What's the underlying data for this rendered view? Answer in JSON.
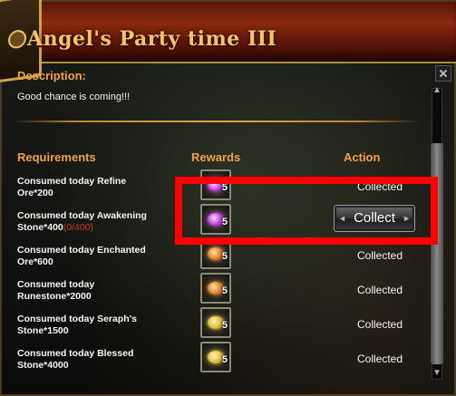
{
  "window": {
    "title": "Angel's Party time III",
    "description_label": "Description:",
    "description_text": "Good chance is coming!!!"
  },
  "headers": {
    "requirements": "Requirements",
    "rewards": "Rewards",
    "action": "Action"
  },
  "rows": [
    {
      "req_line1": "Consumed today Refine",
      "req_line2": "Ore*200",
      "progress": "",
      "reward_qty": "5",
      "reward_icon": "purple-gem-icon",
      "action": "Collected"
    },
    {
      "req_line1": "Consumed today Awakening",
      "req_line2": "Stone*400",
      "progress": "(0/400)",
      "reward_qty": "5",
      "reward_icon": "purple-gem-icon",
      "action": "Collect"
    },
    {
      "req_line1": "Consumed today Enchanted",
      "req_line2": "Ore*600",
      "progress": "",
      "reward_qty": "5",
      "reward_icon": "orange-gem-icon",
      "action": "Collected"
    },
    {
      "req_line1": "Consumed today",
      "req_line2": "Runestone*2000",
      "progress": "",
      "reward_qty": "5",
      "reward_icon": "orange-gem-icon",
      "action": "Collected"
    },
    {
      "req_line1": "Consumed today Seraph's",
      "req_line2": "Stone*1500",
      "progress": "",
      "reward_qty": "5",
      "reward_icon": "gold-gem-icon",
      "action": "Collected"
    },
    {
      "req_line1": "Consumed today Blessed",
      "req_line2": "Stone*4000",
      "progress": "",
      "reward_qty": "5",
      "reward_icon": "gold-gem-icon",
      "action": "Collected"
    }
  ],
  "colors": {
    "header_orange": "#f0a24a",
    "title_gold": "#f2c46a",
    "progress_red": "#d23a2a",
    "highlight_red": "#ff0000"
  }
}
